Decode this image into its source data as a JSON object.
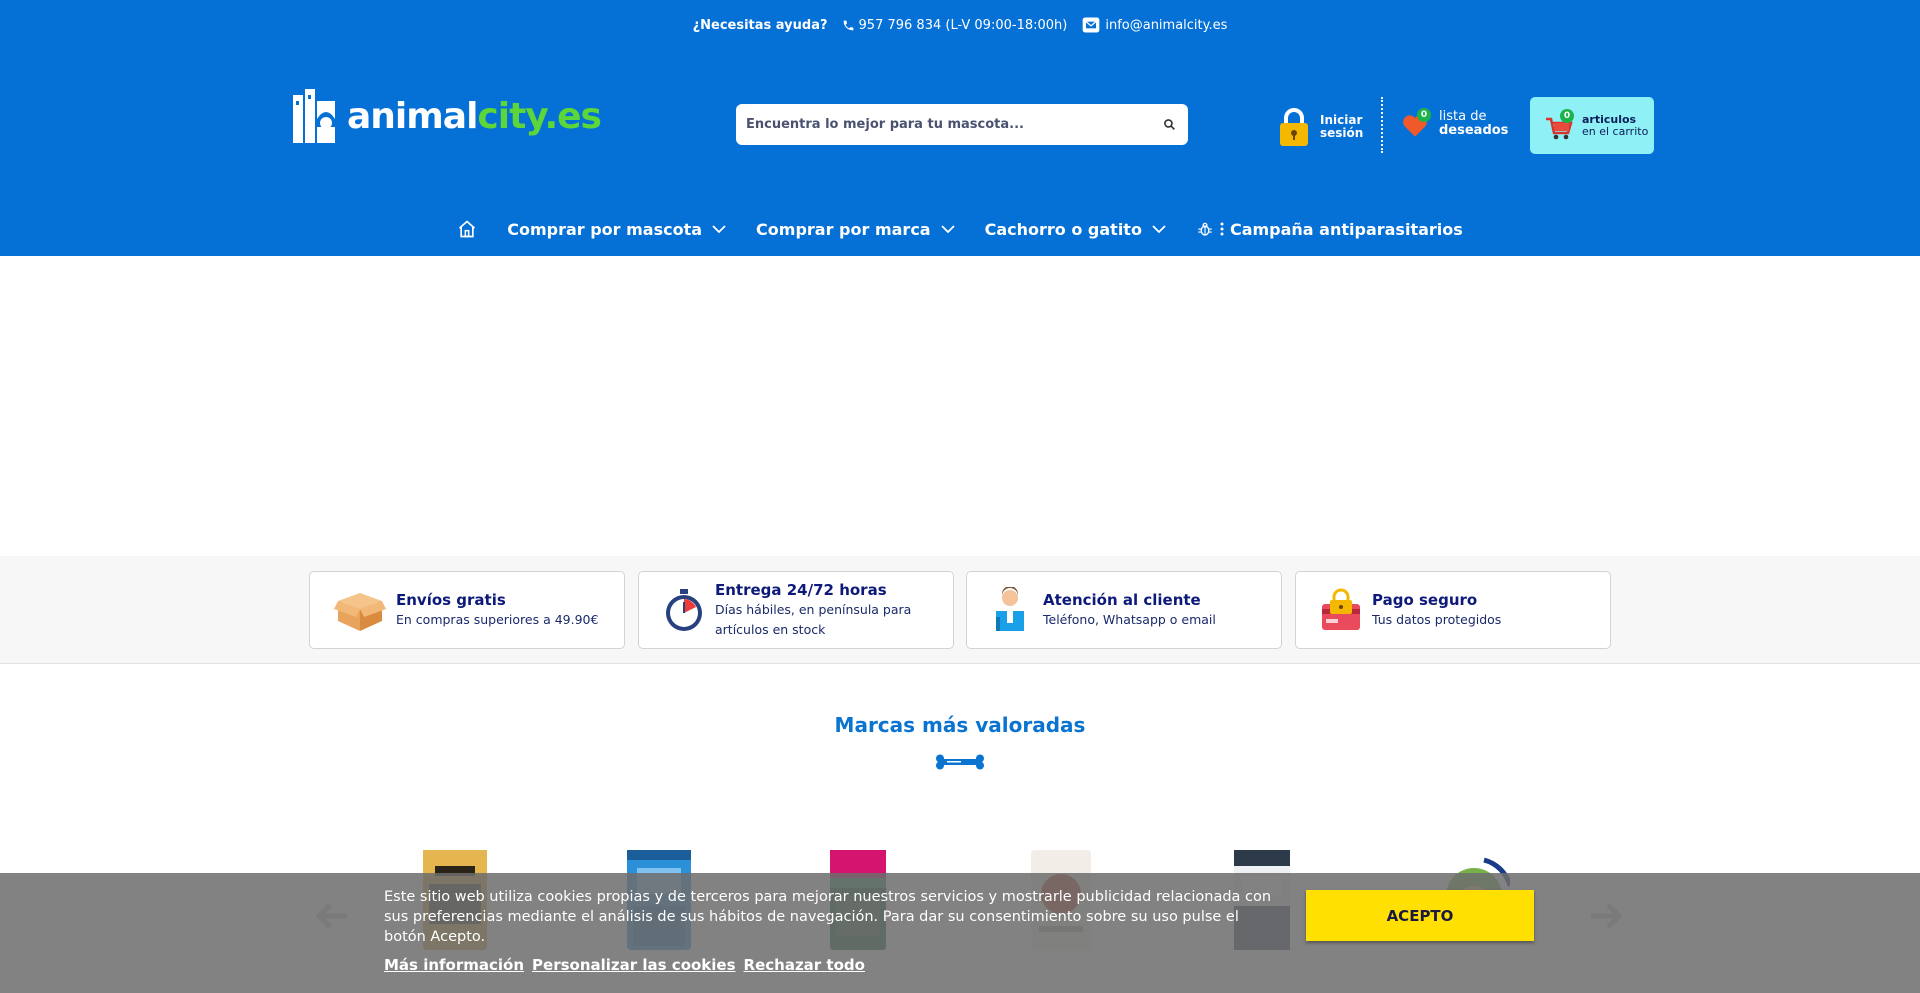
{
  "topbar": {
    "help": "¿Necesitas ayuda?",
    "phone": "957 796 834 (L-V 09:00-18:00h)",
    "email": "info@animalcity.es"
  },
  "logo": {
    "part1": "animal",
    "part2": "city.es"
  },
  "search": {
    "placeholder": "Encuentra lo mejor para tu mascota..."
  },
  "account": {
    "login_line1": "Iniciar",
    "login_line2": "sesión"
  },
  "wishlist": {
    "count": "0",
    "line1": "lista de",
    "line2": "deseados"
  },
  "cart": {
    "count": "0",
    "line1": "articulos",
    "line2": "en el carrito"
  },
  "nav": {
    "items": [
      {
        "label": "Comprar por mascota"
      },
      {
        "label": "Comprar por marca"
      },
      {
        "label": "Cachorro o gatito"
      },
      {
        "label": "Campaña antiparasitarios"
      }
    ]
  },
  "features": [
    {
      "title": "Envíos gratis",
      "desc": "En compras superiores a 49.90€",
      "icon": "box-icon"
    },
    {
      "title": "Entrega 24/72 horas",
      "desc": "Días hábiles, en península para artículos en stock",
      "icon": "stopwatch-icon"
    },
    {
      "title": "Atención al cliente",
      "desc": "Teléfono, Whatsapp o email",
      "icon": "customer-service-icon"
    },
    {
      "title": "Pago seguro",
      "desc": "Tus datos protegidos",
      "icon": "secure-payment-icon"
    }
  ],
  "brands": {
    "title": "Marcas más valoradas"
  },
  "cookie": {
    "text": "Este sitio web utiliza cookies propias y de terceros para mejorar nuestros servicios y mostrarle publicidad relacionada con sus preferencias mediante el análisis de sus hábitos de navegación. Para dar su consentimiento sobre su uso pulse el botón Acepto.",
    "more_info": "Más información",
    "customize": "Personalizar las cookies",
    "reject": "Rechazar todo",
    "accept": "ACEPTO"
  },
  "colors": {
    "header_bg": "#0570d6",
    "accent_green": "#5dd639",
    "cart_bg": "#8ff0f5",
    "accept_bg": "#ffe000",
    "title_blue": "#0a74d0"
  }
}
